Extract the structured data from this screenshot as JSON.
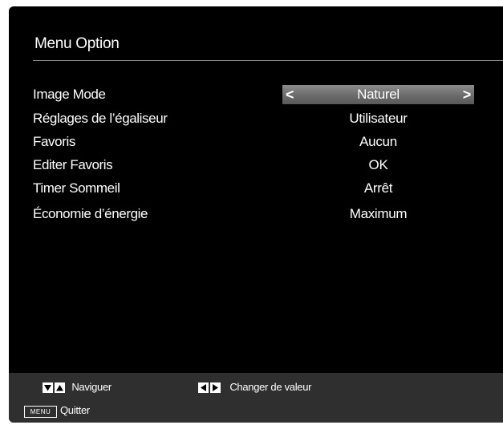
{
  "menu": {
    "title": "Menu Option"
  },
  "options": [
    {
      "label": "Image Mode",
      "value": "Naturel",
      "selected": true
    },
    {
      "label": "Réglages de l’égaliseur",
      "value": "Utilisateur",
      "selected": false
    },
    {
      "label": "Favoris",
      "value": "Aucun",
      "selected": false
    },
    {
      "label": "Editer Favoris",
      "value": "OK",
      "selected": false
    },
    {
      "label": "Timer Sommeil",
      "value": "Arrêt",
      "selected": false
    },
    {
      "label": "Économie d’énergie",
      "value": "Maximum",
      "selected": false
    }
  ],
  "selector": {
    "left_arrow": "<",
    "right_arrow": ">"
  },
  "footer": {
    "navigate_label": "Naviguer",
    "change_value_label": "Changer de valeur",
    "menu_key_label": "MENU",
    "quit_label": "Quitter"
  },
  "colors": {
    "background": "#000000",
    "footer": "#2f2f2f",
    "highlight": "#7a7a7a",
    "text": "#ffffff"
  },
  "icons": [
    "down-triangle-icon",
    "up-triangle-icon",
    "left-triangle-icon",
    "right-triangle-icon",
    "menu-key-icon"
  ]
}
